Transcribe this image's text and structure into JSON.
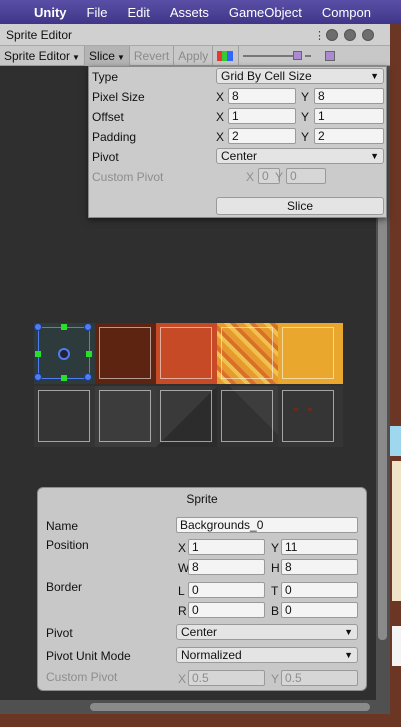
{
  "menubar": {
    "app": "Unity",
    "items": [
      "File",
      "Edit",
      "Assets",
      "GameObject",
      "Compon"
    ]
  },
  "window": {
    "title": "Sprite Editor"
  },
  "toolbar": {
    "mode_label": "Sprite Editor",
    "slice_label": "Slice",
    "revert_label": "Revert",
    "apply_label": "Apply"
  },
  "slice_panel": {
    "type_label": "Type",
    "type_value": "Grid By Cell Size",
    "pixel_size_label": "Pixel Size",
    "pixel_size": {
      "x": "8",
      "y": "8"
    },
    "offset_label": "Offset",
    "offset": {
      "x": "1",
      "y": "1"
    },
    "padding_label": "Padding",
    "padding": {
      "x": "2",
      "y": "2"
    },
    "pivot_label": "Pivot",
    "pivot_value": "Center",
    "custom_pivot_label": "Custom Pivot",
    "custom_pivot": {
      "x": "0",
      "y": "0"
    },
    "slice_button": "Slice",
    "x_axis": "X",
    "y_axis": "Y"
  },
  "tiles": {
    "top_colors": [
      "#2e3b3c",
      "#5e2412",
      "#c54a25",
      "#e79a2e",
      "#e9a72e"
    ],
    "bottom_color": "#353535"
  },
  "sprite_panel": {
    "header": "Sprite",
    "name_label": "Name",
    "name_value": "Backgrounds_0",
    "position_label": "Position",
    "pos_x": "1",
    "pos_y": "11",
    "pos_w": "8",
    "pos_h": "8",
    "border_label": "Border",
    "border_l": "0",
    "border_t": "0",
    "border_r": "0",
    "border_b": "0",
    "pivot_label": "Pivot",
    "pivot_value": "Center",
    "pivot_unit_label": "Pivot Unit Mode",
    "pivot_unit_value": "Normalized",
    "custom_pivot_label": "Custom Pivot",
    "custom_pivot_x": "0.5",
    "custom_pivot_y": "0.5",
    "letters": {
      "x": "X",
      "y": "Y",
      "w": "W",
      "h": "H",
      "l": "L",
      "t": "T",
      "r": "R",
      "b": "B"
    }
  }
}
